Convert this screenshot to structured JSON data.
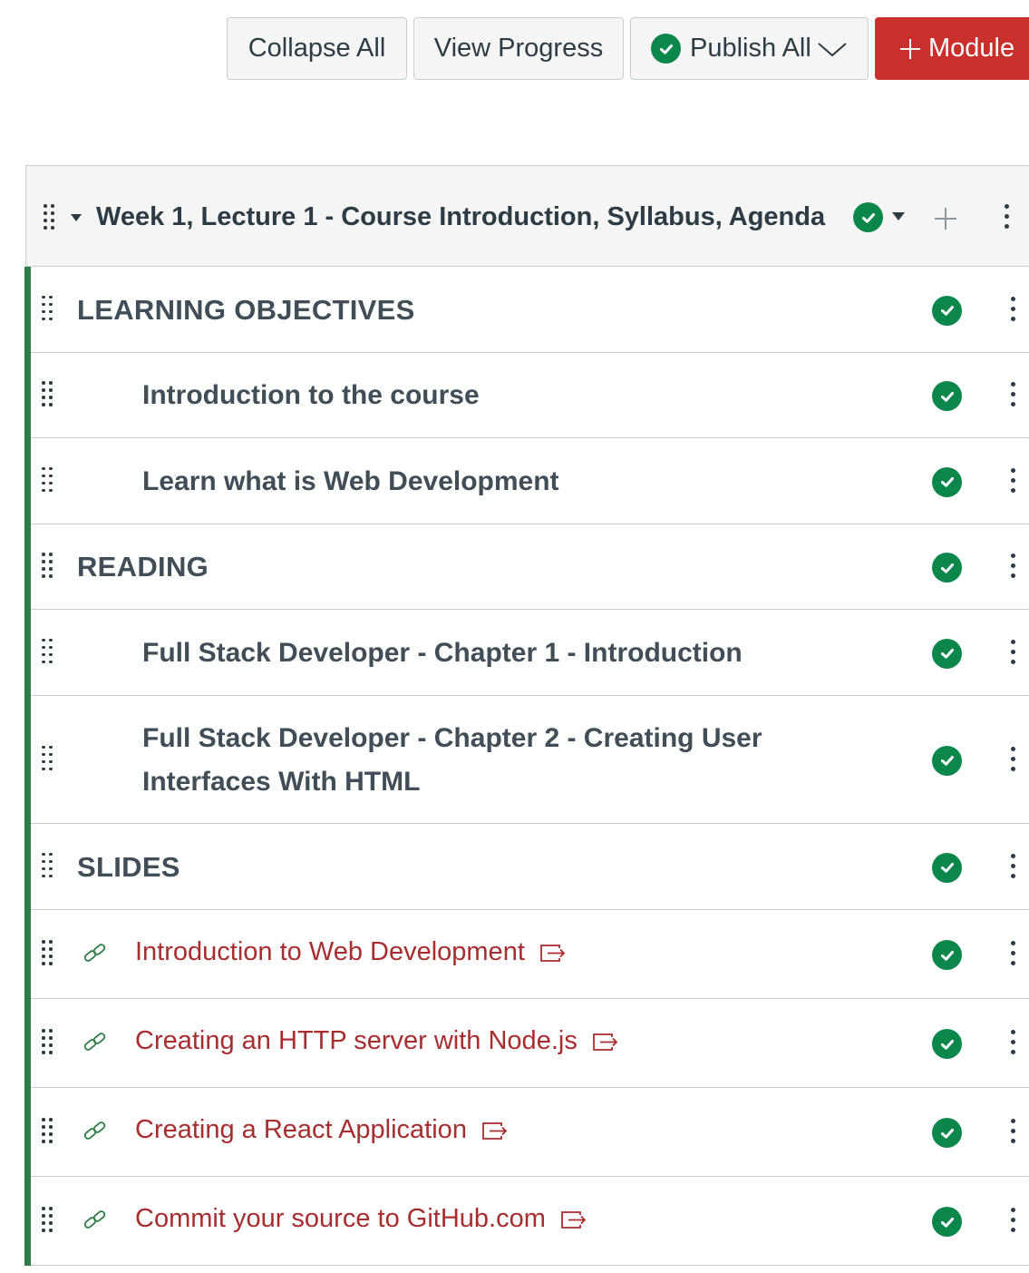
{
  "toolbar": {
    "collapse_all": "Collapse All",
    "view_progress": "View Progress",
    "publish_all": "Publish All",
    "add_module": "Module"
  },
  "module": {
    "title": "Week 1, Lecture 1 - Course Introduction, Syllabus, Agenda",
    "items": [
      {
        "type": "header",
        "label": "LEARNING OBJECTIVES"
      },
      {
        "type": "page",
        "label": "Introduction to the course"
      },
      {
        "type": "page",
        "label": "Learn what is Web Development"
      },
      {
        "type": "header",
        "label": "READING"
      },
      {
        "type": "page",
        "label": "Full Stack Developer - Chapter 1 - Introduction"
      },
      {
        "type": "page",
        "label": "Full Stack Developer - Chapter 2 - Creating User Interfaces With HTML"
      },
      {
        "type": "header",
        "label": "SLIDES"
      },
      {
        "type": "link",
        "label": "Introduction to Web Development"
      },
      {
        "type": "link",
        "label": "Creating an HTTP server with Node.js"
      },
      {
        "type": "link",
        "label": "Creating a React Application"
      },
      {
        "type": "link",
        "label": "Commit your source to GitHub.com"
      }
    ]
  },
  "colors": {
    "published_green": "#0b874b",
    "module_accent": "#2e7d46",
    "link_red": "#a72d2f",
    "button_red": "#c9302c"
  },
  "icons": [
    "drag-handle-icon",
    "caret-down-icon",
    "published-check-icon",
    "plus-icon",
    "kebab-menu-icon",
    "link-icon",
    "external-link-icon",
    "chevron-down-icon"
  ]
}
